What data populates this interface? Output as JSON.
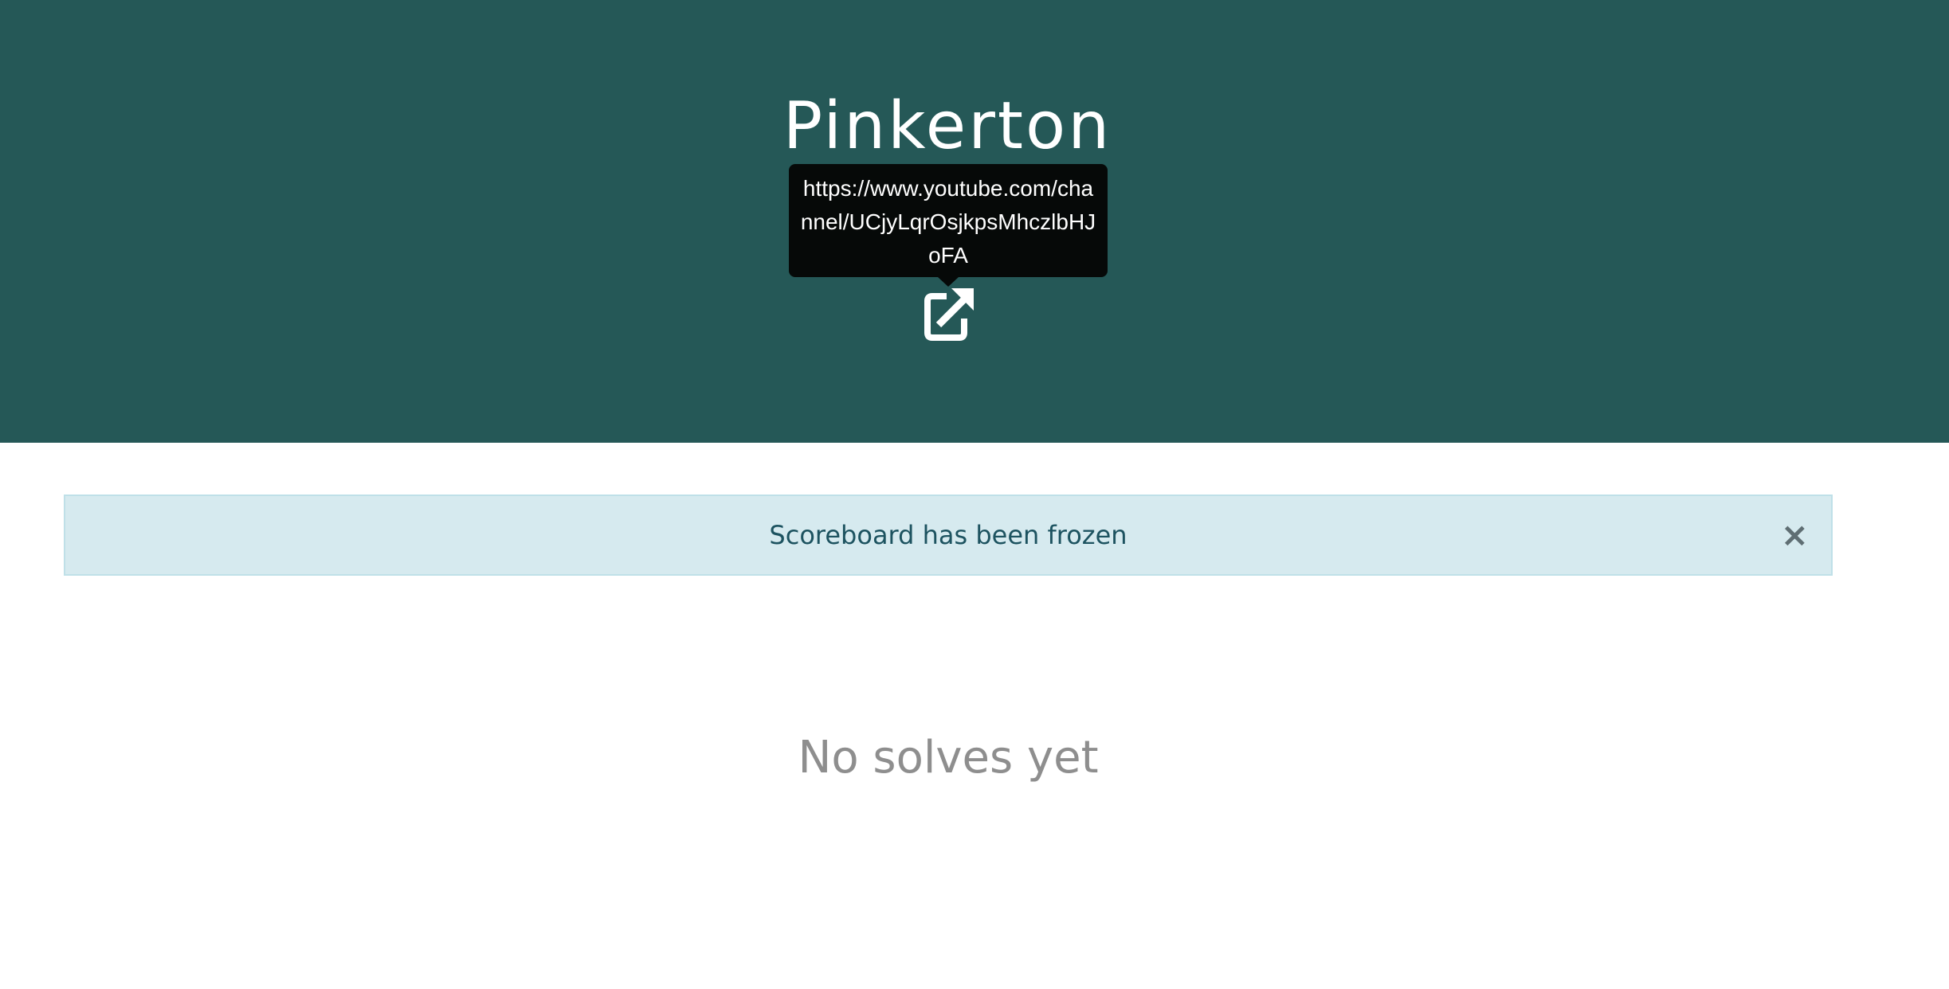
{
  "header": {
    "team_name": "Pinkerton",
    "link_tooltip": "https://www.youtube.com/channel/UCjyLqrOsjkpsMhczlbHJoFA",
    "link_icon": "external-link-icon",
    "background_color": "#255857"
  },
  "alert": {
    "message": "Scoreboard has been frozen",
    "close_label": "×",
    "background_color": "#d6eaef"
  },
  "main": {
    "empty_message": "No solves yet"
  }
}
